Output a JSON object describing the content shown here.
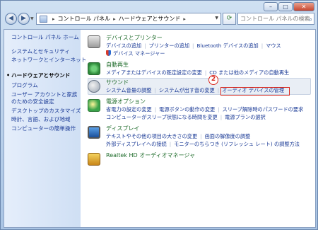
{
  "window": {
    "caption": {
      "minimize": "–",
      "maximize": "□",
      "close": "✕"
    }
  },
  "address_bar": {
    "segments": [
      "コントロール パネル",
      "ハードウェアとサウンド"
    ],
    "separator": "▸",
    "search_placeholder": "コントロール パネルの検索"
  },
  "sidebar": {
    "items": [
      {
        "label": "コントロール パネル ホーム",
        "current": false
      },
      {
        "label": "システムとセキュリティ",
        "current": false
      },
      {
        "label": "ネットワークとインターネット",
        "current": false
      },
      {
        "label": "ハードウェアとサウンド",
        "current": true
      },
      {
        "label": "プログラム",
        "current": false
      },
      {
        "label": "ユーザー アカウントと家族",
        "current": false
      },
      {
        "label": "のための安全設定",
        "current": false
      },
      {
        "label": "デスクトップのカスタマイズ",
        "current": false
      },
      {
        "label": "時計、言語、および地域",
        "current": false
      },
      {
        "label": "コンピューターの簡単操作",
        "current": false
      }
    ]
  },
  "categories": {
    "devices": {
      "title": "デバイスとプリンター",
      "links": [
        "デバイスの追加",
        "プリンターの追加",
        "Bluetooth デバイスの追加",
        "マウス"
      ],
      "links2": [
        "デバイス マネージャー"
      ]
    },
    "autoplay": {
      "title": "自動再生",
      "links": [
        "メディアまたはデバイスの既定設定の変更",
        "CD または他のメディアの自動再生"
      ]
    },
    "sound": {
      "title": "サウンド",
      "links": [
        "システム音量の調整",
        "システムが出す音の変更",
        "オーディオ デバイスの管理"
      ]
    },
    "power": {
      "title": "電源オプション",
      "links": [
        "省電力の設定の変更",
        "電源ボタンの動作の変更",
        "スリープ解除時のパスワードの要求"
      ],
      "links2": [
        "コンピューターがスリープ状態になる時間を変更",
        "電源プランの選択"
      ]
    },
    "display": {
      "title": "ディスプレイ",
      "links": [
        "テキストやその他の項目の大きさの変更",
        "画面の解像度の調整"
      ],
      "links2": [
        "外部ディスプレイへの接続",
        "モニターのちらつき (リフレッシュ レート) の調整方法"
      ]
    },
    "realtek": {
      "title": "Realtek HD オーディオマネージャ"
    }
  },
  "callout": {
    "number": "2"
  }
}
